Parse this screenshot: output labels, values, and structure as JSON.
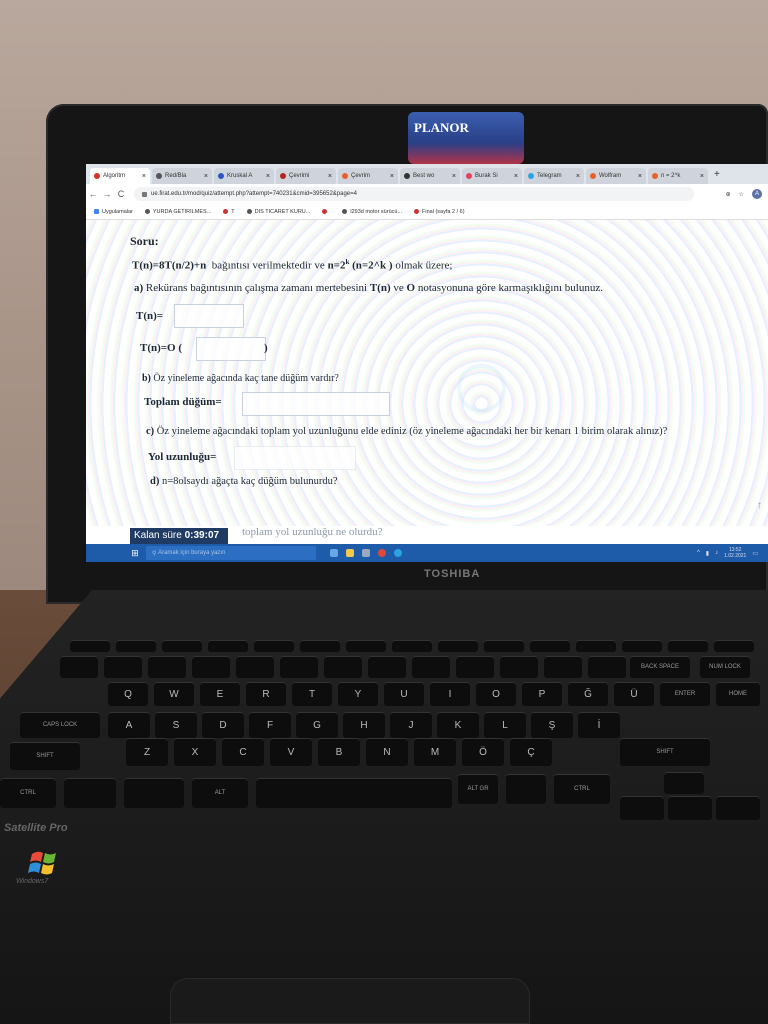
{
  "sticker": {
    "brand": "PLANOR",
    "sub": ""
  },
  "browser": {
    "tabs": [
      {
        "label": "Algoritm",
        "color": "#d93025",
        "active": true
      },
      {
        "label": "Red/Bla",
        "color": "#555555",
        "active": false
      },
      {
        "label": "Kruskal A",
        "color": "#2a56c6",
        "active": false
      },
      {
        "label": "Çevrimi",
        "color": "#b3261e",
        "active": false
      },
      {
        "label": "Çevrim",
        "color": "#e8612c",
        "active": false
      },
      {
        "label": "Best wo",
        "color": "#333333",
        "active": false
      },
      {
        "label": "Burak Si",
        "color": "#e4405f",
        "active": false
      },
      {
        "label": "Telegram",
        "color": "#2aa3e0",
        "active": false
      },
      {
        "label": "Wolfram",
        "color": "#e8612c",
        "active": false
      },
      {
        "label": "n = 2^k",
        "color": "#e8612c",
        "active": false
      }
    ],
    "new_tab": "+",
    "url": "ue.firat.edu.tr/mod/quiz/attempt.php?attempt=740231&cmid=395652&page=4",
    "avatar_letter": "A",
    "bookmarks": [
      {
        "label": "Uygulamalar",
        "icon": "apps-icon"
      },
      {
        "label": "YURDA GETIRILMES...",
        "icon": "globe-icon"
      },
      {
        "label": "T",
        "icon": "globe-icon"
      },
      {
        "label": "DIS TICARET KURU...",
        "icon": "globe-icon"
      },
      {
        "label": "",
        "icon": "globe-icon"
      },
      {
        "label": "l293d motor sürücü...",
        "icon": "globe-icon"
      },
      {
        "label": "Final (sayfa 2 / 6)",
        "icon": "globe-icon"
      }
    ]
  },
  "quiz": {
    "soru": "Soru:",
    "recurrence_left": "T(n)=8T(n/2)+n",
    "recurrence_mid": "bağıntısı verilmektedir ve",
    "n_expr": "n=2",
    "n_exp": "k",
    "n_paren": "(n=2^k )",
    "recurrence_right": "olmak üzere;",
    "a_label": "a)",
    "a_text_1": "Rekürans bağıntısının çalışma zamanı mertebesini",
    "a_Tn": "T(n)",
    "a_text_2": "ve",
    "a_O": "O",
    "a_text_3": "notasyonuna göre karmaşıklığını bulunuz.",
    "tn_label": "T(n)=",
    "to_label": "T(n)=O (",
    "to_close": ")",
    "b_label": "b)",
    "b_text": "Öz yineleme ağacında kaç tane düğüm vardır?",
    "toplam_label": "Toplam düğüm=",
    "c_label": "c)",
    "c_text": "Öz yineleme ağacındaki toplam yol uzunluğunu elde ediniz (öz yineleme ağacındaki her bir kenarı 1 birim olarak alınız)?",
    "yol_label": "Yol uzunluğu=",
    "d_label": "d)",
    "d_text": "n=8olsaydı ağaçta kaç düğüm bulunurdu?",
    "under_text": "toplam yol uzunluğu ne olurdu?"
  },
  "timer": {
    "label": "Kalan süre",
    "value": "0:39:07"
  },
  "taskbar": {
    "search_placeholder": "Aramak için buraya yazın",
    "time": "13:52",
    "date": "1.02.2021"
  },
  "laptop": {
    "brand": "TOSHIBA",
    "model": "Satellite Pro",
    "os_badge": "Windows7"
  },
  "keys": {
    "row_q": [
      "Q",
      "W",
      "E",
      "R",
      "T",
      "Y",
      "U",
      "I",
      "O",
      "P",
      "Ğ",
      "Ü"
    ],
    "row_a": [
      "A",
      "S",
      "D",
      "F",
      "G",
      "H",
      "J",
      "K",
      "L",
      "Ş",
      "İ"
    ],
    "row_z": [
      "Z",
      "X",
      "C",
      "V",
      "B",
      "N",
      "M",
      "Ö",
      "Ç"
    ],
    "caps": "CAPS LOCK",
    "shift": "SHIFT",
    "shift_r": "SHIFT",
    "ctrl": "CTRL",
    "ctrl_r": "CTRL",
    "alt": "ALT",
    "altgr": "ALT GR",
    "enter": "ENTER",
    "backspace": "BACK SPACE",
    "home": "HOME",
    "num_lock": "NUM LOCK"
  }
}
